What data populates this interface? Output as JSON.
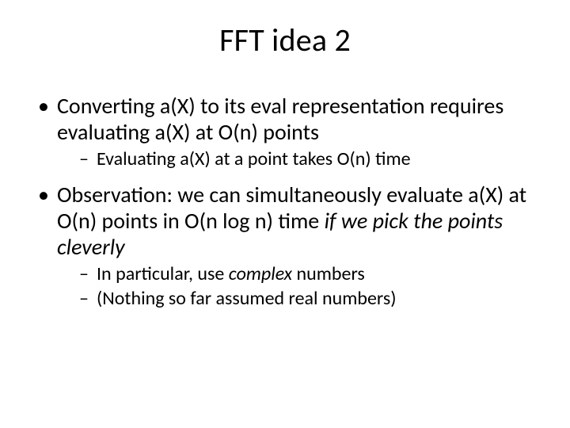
{
  "title": "FFT idea 2",
  "b1": "Converting a(X) to its eval representation requires evaluating a(X) at O(n) points",
  "b1s1": "Evaluating a(X) at a point takes O(n) time",
  "b2a": "Observation: we can simultaneously evaluate a(X) at O(n) points in O(n log n) time ",
  "b2b": "if we pick the points cleverly",
  "b2s1a": "In particular, use ",
  "b2s1b": "complex",
  "b2s1c": " numbers",
  "b2s2": "(Nothing so far assumed real numbers)"
}
